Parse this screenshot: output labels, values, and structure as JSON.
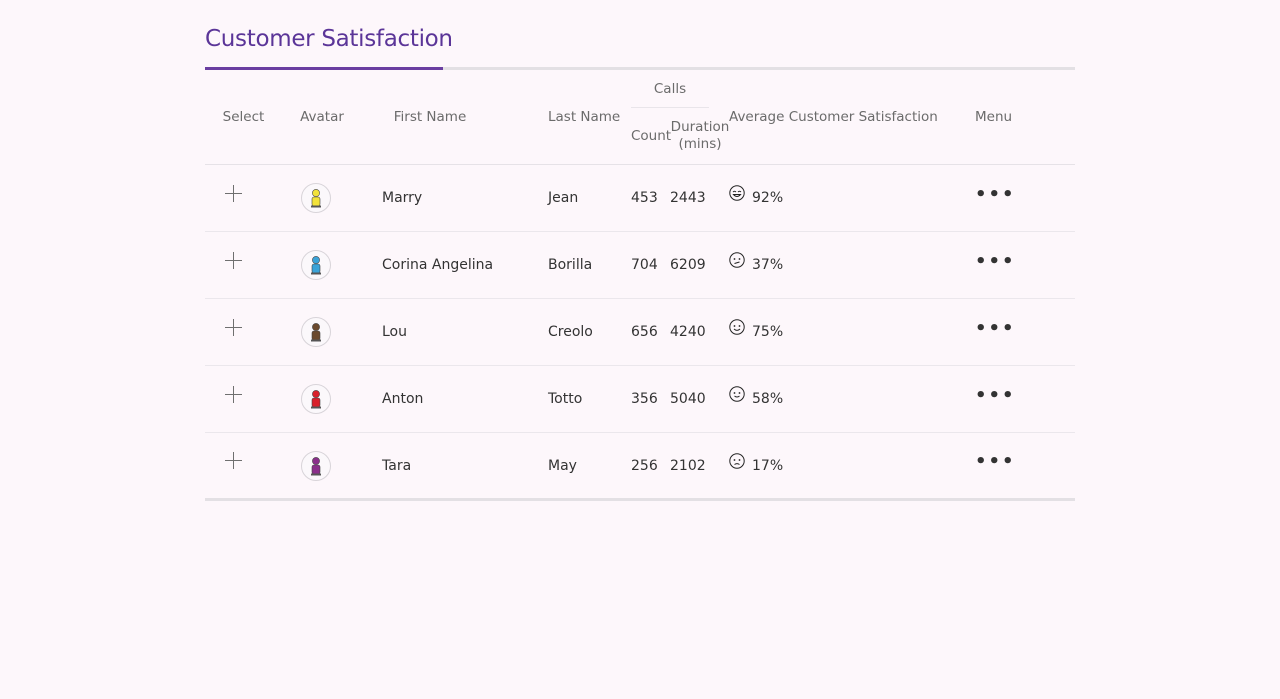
{
  "title": "Customer Satisfaction",
  "headers": {
    "select": "Select",
    "avatar": "Avatar",
    "first_name": "First Name",
    "last_name": "Last Name",
    "calls": "Calls",
    "count": "Count",
    "duration": "Duration (mins)",
    "satisfaction": "Average Customer Satisfaction",
    "menu": "Menu"
  },
  "rows": [
    {
      "first": "Marry",
      "last": "Jean",
      "count": "453",
      "duration": "2443",
      "satisfaction": "92%",
      "mood": "very-happy-face-icon",
      "avatar_color": "#f2e23a"
    },
    {
      "first": "Corina Angelina",
      "last": "Borilla",
      "count": "704",
      "duration": "6209",
      "satisfaction": "37%",
      "mood": "unhappy-face-icon",
      "avatar_color": "#3aa3d8"
    },
    {
      "first": "Lou",
      "last": "Creolo",
      "count": "656",
      "duration": "4240",
      "satisfaction": "75%",
      "mood": "happy-face-icon",
      "avatar_color": "#6b4a2e"
    },
    {
      "first": "Anton",
      "last": "Totto",
      "count": "356",
      "duration": "5040",
      "satisfaction": "58%",
      "mood": "smile-face-icon",
      "avatar_color": "#d8202a"
    },
    {
      "first": "Tara",
      "last": "May",
      "count": "256",
      "duration": "2102",
      "satisfaction": "17%",
      "mood": "sad-face-icon",
      "avatar_color": "#8a2e8a"
    }
  ],
  "colors": {
    "accent": "#6a3ea1",
    "background": "#fdf7fb"
  }
}
